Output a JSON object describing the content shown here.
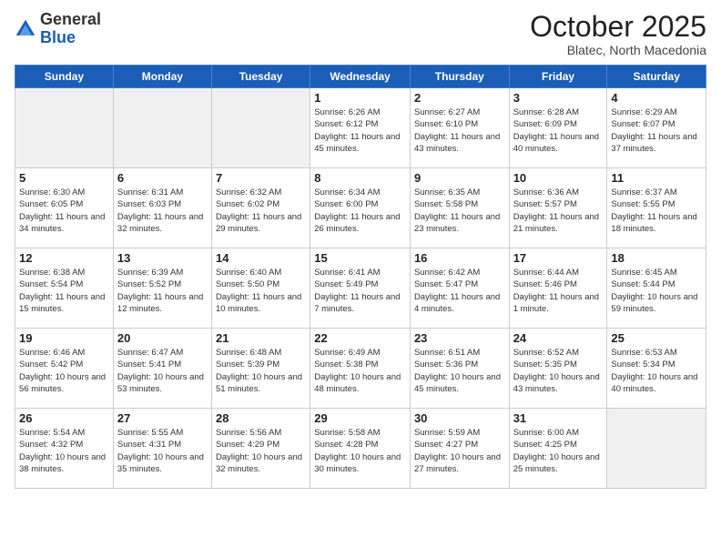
{
  "logo": {
    "general": "General",
    "blue": "Blue"
  },
  "title": "October 2025",
  "subtitle": "Blatec, North Macedonia",
  "days_of_week": [
    "Sunday",
    "Monday",
    "Tuesday",
    "Wednesday",
    "Thursday",
    "Friday",
    "Saturday"
  ],
  "weeks": [
    [
      {
        "day": "",
        "info": ""
      },
      {
        "day": "",
        "info": ""
      },
      {
        "day": "",
        "info": ""
      },
      {
        "day": "1",
        "info": "Sunrise: 6:26 AM\nSunset: 6:12 PM\nDaylight: 11 hours\nand 45 minutes."
      },
      {
        "day": "2",
        "info": "Sunrise: 6:27 AM\nSunset: 6:10 PM\nDaylight: 11 hours\nand 43 minutes."
      },
      {
        "day": "3",
        "info": "Sunrise: 6:28 AM\nSunset: 6:09 PM\nDaylight: 11 hours\nand 40 minutes."
      },
      {
        "day": "4",
        "info": "Sunrise: 6:29 AM\nSunset: 6:07 PM\nDaylight: 11 hours\nand 37 minutes."
      }
    ],
    [
      {
        "day": "5",
        "info": "Sunrise: 6:30 AM\nSunset: 6:05 PM\nDaylight: 11 hours\nand 34 minutes."
      },
      {
        "day": "6",
        "info": "Sunrise: 6:31 AM\nSunset: 6:03 PM\nDaylight: 11 hours\nand 32 minutes."
      },
      {
        "day": "7",
        "info": "Sunrise: 6:32 AM\nSunset: 6:02 PM\nDaylight: 11 hours\nand 29 minutes."
      },
      {
        "day": "8",
        "info": "Sunrise: 6:34 AM\nSunset: 6:00 PM\nDaylight: 11 hours\nand 26 minutes."
      },
      {
        "day": "9",
        "info": "Sunrise: 6:35 AM\nSunset: 5:58 PM\nDaylight: 11 hours\nand 23 minutes."
      },
      {
        "day": "10",
        "info": "Sunrise: 6:36 AM\nSunset: 5:57 PM\nDaylight: 11 hours\nand 21 minutes."
      },
      {
        "day": "11",
        "info": "Sunrise: 6:37 AM\nSunset: 5:55 PM\nDaylight: 11 hours\nand 18 minutes."
      }
    ],
    [
      {
        "day": "12",
        "info": "Sunrise: 6:38 AM\nSunset: 5:54 PM\nDaylight: 11 hours\nand 15 minutes."
      },
      {
        "day": "13",
        "info": "Sunrise: 6:39 AM\nSunset: 5:52 PM\nDaylight: 11 hours\nand 12 minutes."
      },
      {
        "day": "14",
        "info": "Sunrise: 6:40 AM\nSunset: 5:50 PM\nDaylight: 11 hours\nand 10 minutes."
      },
      {
        "day": "15",
        "info": "Sunrise: 6:41 AM\nSunset: 5:49 PM\nDaylight: 11 hours\nand 7 minutes."
      },
      {
        "day": "16",
        "info": "Sunrise: 6:42 AM\nSunset: 5:47 PM\nDaylight: 11 hours\nand 4 minutes."
      },
      {
        "day": "17",
        "info": "Sunrise: 6:44 AM\nSunset: 5:46 PM\nDaylight: 11 hours\nand 1 minute."
      },
      {
        "day": "18",
        "info": "Sunrise: 6:45 AM\nSunset: 5:44 PM\nDaylight: 10 hours\nand 59 minutes."
      }
    ],
    [
      {
        "day": "19",
        "info": "Sunrise: 6:46 AM\nSunset: 5:42 PM\nDaylight: 10 hours\nand 56 minutes."
      },
      {
        "day": "20",
        "info": "Sunrise: 6:47 AM\nSunset: 5:41 PM\nDaylight: 10 hours\nand 53 minutes."
      },
      {
        "day": "21",
        "info": "Sunrise: 6:48 AM\nSunset: 5:39 PM\nDaylight: 10 hours\nand 51 minutes."
      },
      {
        "day": "22",
        "info": "Sunrise: 6:49 AM\nSunset: 5:38 PM\nDaylight: 10 hours\nand 48 minutes."
      },
      {
        "day": "23",
        "info": "Sunrise: 6:51 AM\nSunset: 5:36 PM\nDaylight: 10 hours\nand 45 minutes."
      },
      {
        "day": "24",
        "info": "Sunrise: 6:52 AM\nSunset: 5:35 PM\nDaylight: 10 hours\nand 43 minutes."
      },
      {
        "day": "25",
        "info": "Sunrise: 6:53 AM\nSunset: 5:34 PM\nDaylight: 10 hours\nand 40 minutes."
      }
    ],
    [
      {
        "day": "26",
        "info": "Sunrise: 5:54 AM\nSunset: 4:32 PM\nDaylight: 10 hours\nand 38 minutes."
      },
      {
        "day": "27",
        "info": "Sunrise: 5:55 AM\nSunset: 4:31 PM\nDaylight: 10 hours\nand 35 minutes."
      },
      {
        "day": "28",
        "info": "Sunrise: 5:56 AM\nSunset: 4:29 PM\nDaylight: 10 hours\nand 32 minutes."
      },
      {
        "day": "29",
        "info": "Sunrise: 5:58 AM\nSunset: 4:28 PM\nDaylight: 10 hours\nand 30 minutes."
      },
      {
        "day": "30",
        "info": "Sunrise: 5:59 AM\nSunset: 4:27 PM\nDaylight: 10 hours\nand 27 minutes."
      },
      {
        "day": "31",
        "info": "Sunrise: 6:00 AM\nSunset: 4:25 PM\nDaylight: 10 hours\nand 25 minutes."
      },
      {
        "day": "",
        "info": ""
      }
    ]
  ]
}
